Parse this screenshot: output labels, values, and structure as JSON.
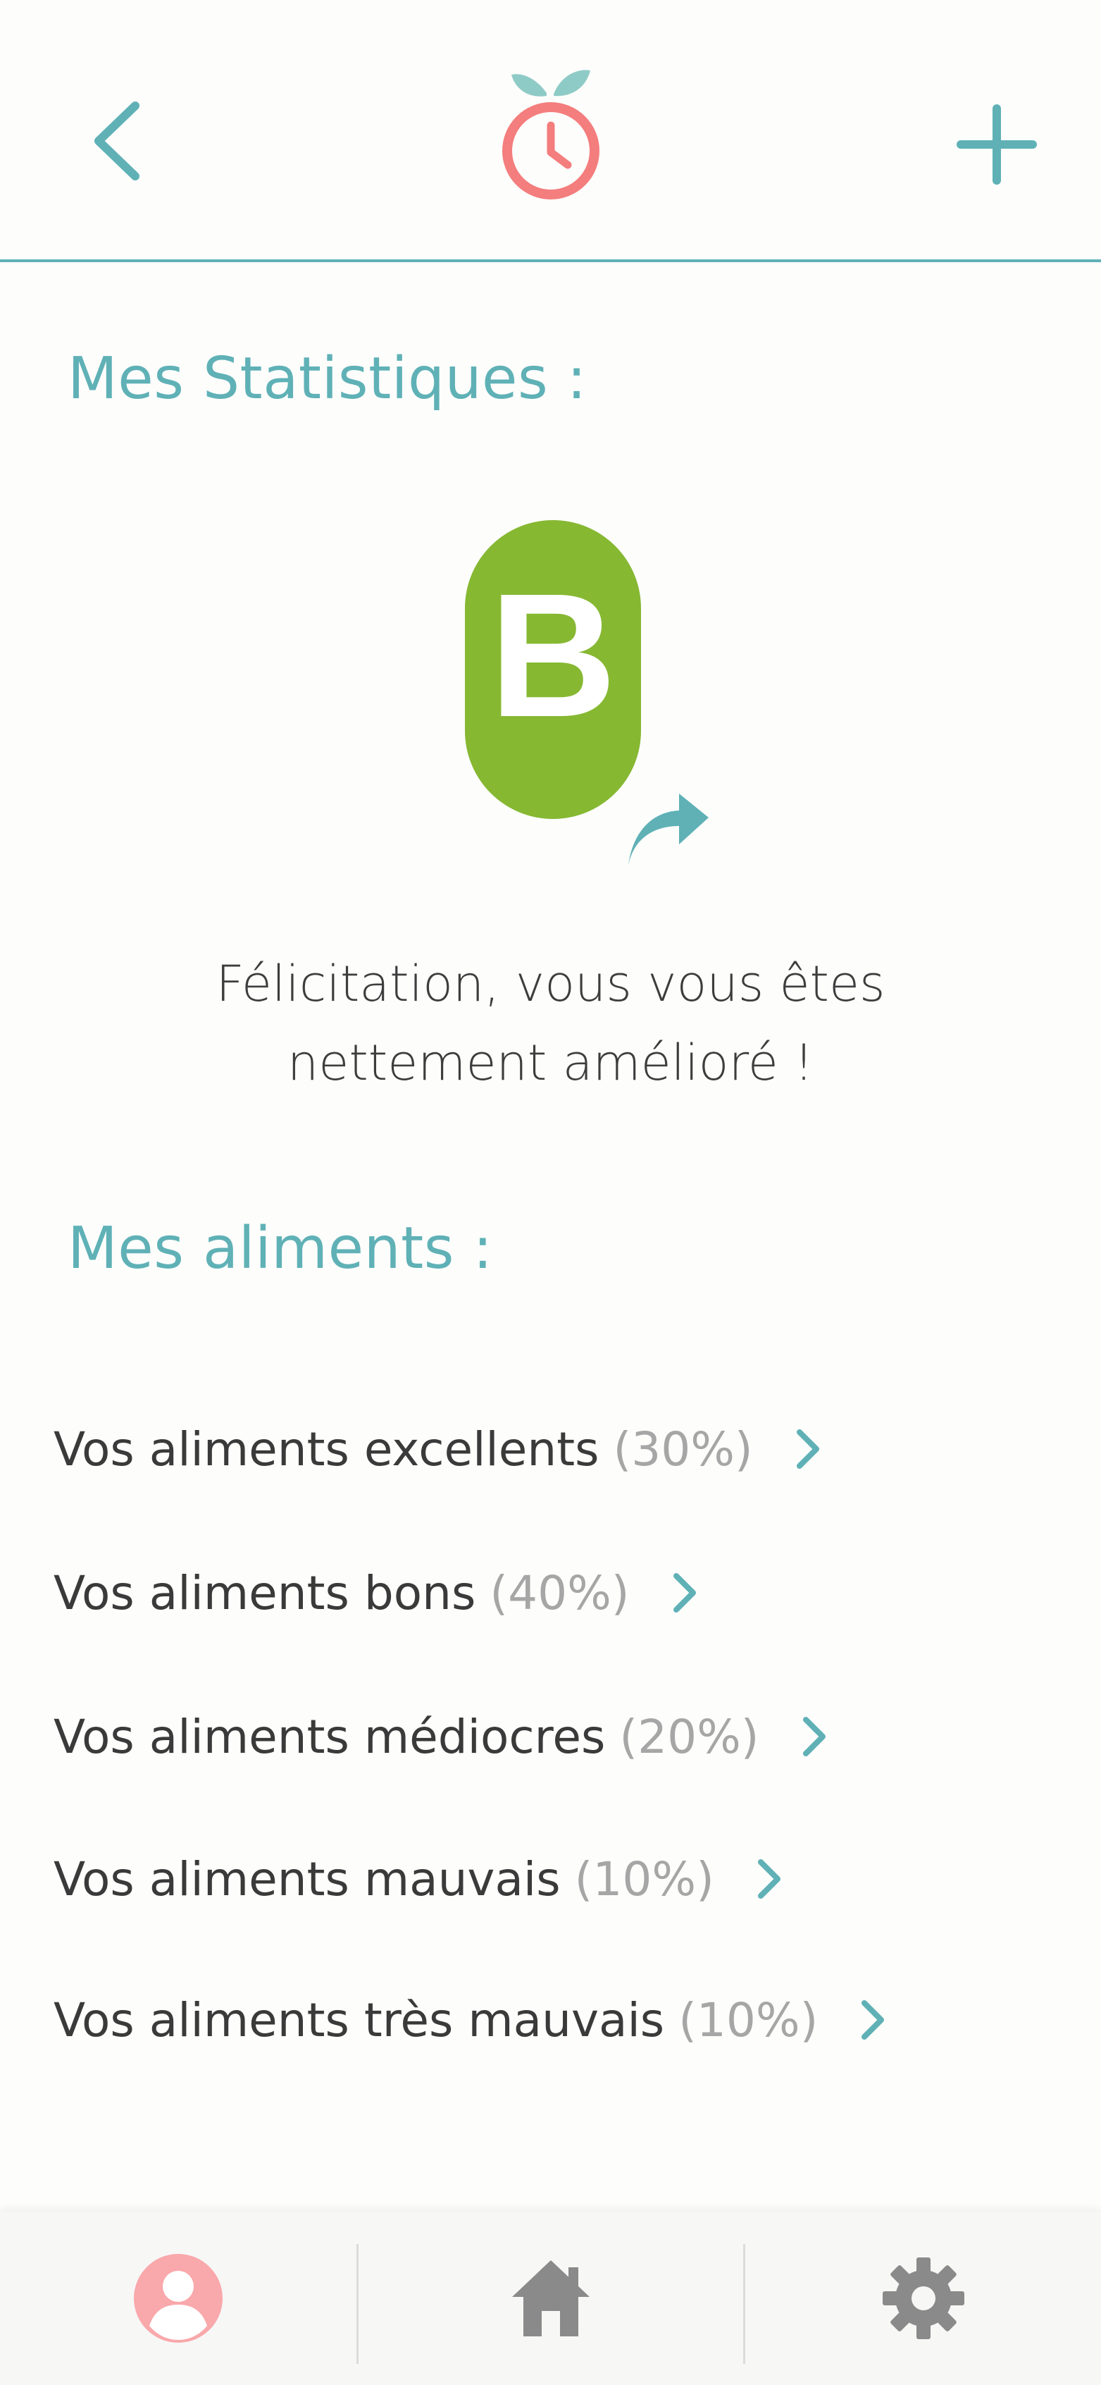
{
  "header": {
    "back_icon": "chevron-left-icon",
    "logo_icon": "apple-clock-logo",
    "add_icon": "plus-icon"
  },
  "stats": {
    "title": "Mes Statistiques :",
    "grade": "B",
    "grade_color": "#86b832",
    "share_icon": "share-arrow-icon",
    "message_line1": "Félicitation, vous vous êtes",
    "message_line2": "nettement amélioré !"
  },
  "aliments": {
    "title": "Mes aliments :",
    "items": [
      {
        "label": "Vos aliments excellents",
        "pct": "(30%)"
      },
      {
        "label": "Vos aliments bons",
        "pct": "(40%)"
      },
      {
        "label": "Vos aliments médiocres",
        "pct": "(20%)"
      },
      {
        "label": "Vos aliments mauvais",
        "pct": "(10%)"
      },
      {
        "label": "Vos aliments très mauvais",
        "pct": "(10%)"
      }
    ]
  },
  "tabbar": {
    "tabs": [
      {
        "icon": "profile-icon",
        "active": true
      },
      {
        "icon": "home-icon",
        "active": false
      },
      {
        "icon": "settings-gear-icon",
        "active": false
      }
    ]
  },
  "colors": {
    "accent": "#5fb1b6",
    "logo_red": "#f47d7d",
    "leaf": "#8fcbc6",
    "profile_pink": "#f9a8ab",
    "icon_gray": "#8a8a8a"
  }
}
